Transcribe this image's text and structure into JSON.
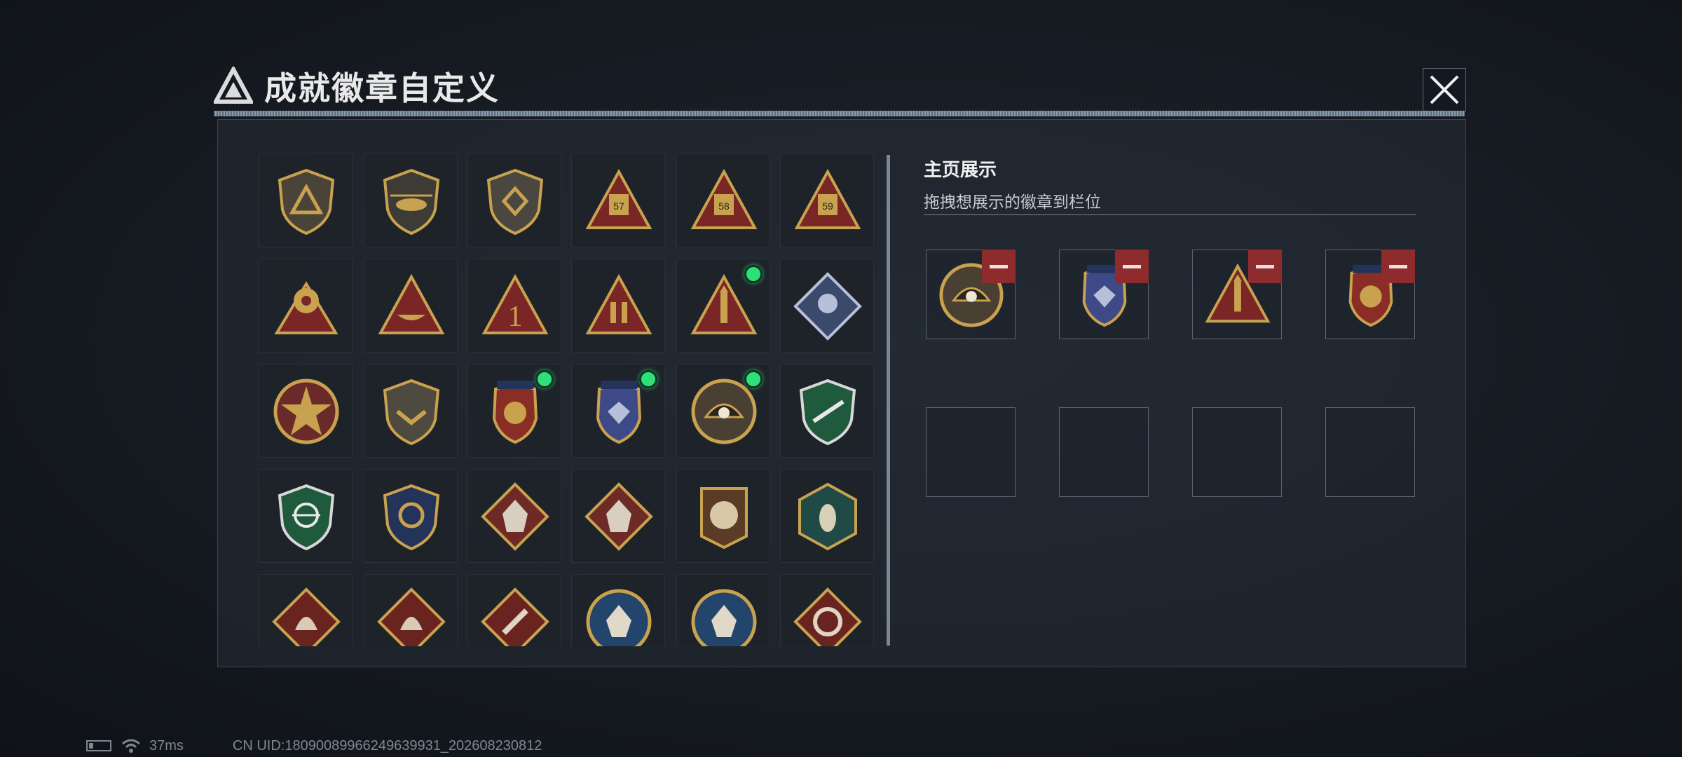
{
  "title": "成就徽章自定义",
  "right_panel": {
    "title": "主页展示",
    "subtitle": "拖拽想展示的徽章到栏位"
  },
  "status": {
    "ping": "37ms",
    "uid": "CN UID:1809008996624963993‌1_202608230812"
  },
  "colors": {
    "accent_green": "#2ee07a",
    "remove_red": "#8e2b2c",
    "gold": "#c9a24f"
  },
  "badges": [
    {
      "icon": "shield-logo-icon",
      "new": false
    },
    {
      "icon": "shield-helicopter-icon",
      "new": false
    },
    {
      "icon": "shield-emblem-icon",
      "new": false
    },
    {
      "icon": "triangle-57-icon",
      "new": false
    },
    {
      "icon": "triangle-58-icon",
      "new": false
    },
    {
      "icon": "triangle-59-icon",
      "new": false
    },
    {
      "icon": "triangle-gears-icon",
      "new": false
    },
    {
      "icon": "triangle-boat-icon",
      "new": false
    },
    {
      "icon": "triangle-number-one-icon",
      "new": false
    },
    {
      "icon": "triangle-soldiers-icon",
      "new": false
    },
    {
      "icon": "triangle-rocket-icon",
      "new": true
    },
    {
      "icon": "diamond-rose-icon",
      "new": false
    },
    {
      "icon": "star-medal-icon",
      "new": false
    },
    {
      "icon": "shield-chevron-icon",
      "new": false
    },
    {
      "icon": "crest-gold-icon",
      "new": true
    },
    {
      "icon": "crest-silver-icon",
      "new": true
    },
    {
      "icon": "circle-pearl-icon",
      "new": true
    },
    {
      "icon": "shield-green-rifle-icon",
      "new": false
    },
    {
      "icon": "shield-green-crosshair-icon",
      "new": false
    },
    {
      "icon": "shield-gold-crosshair-icon",
      "new": false
    },
    {
      "icon": "diamond-wolf-icon",
      "new": false
    },
    {
      "icon": "diamond-wolf-alt-icon",
      "new": false
    },
    {
      "icon": "square-lion-icon",
      "new": false
    },
    {
      "icon": "hexagon-wasp-icon",
      "new": false
    },
    {
      "icon": "diamond-dragon-icon",
      "new": false
    },
    {
      "icon": "diamond-dragon-alt-icon",
      "new": false
    },
    {
      "icon": "diamond-runner-icon",
      "new": false
    },
    {
      "icon": "circle-lynx-icon",
      "new": false
    },
    {
      "icon": "circle-lynx-alt-icon",
      "new": false
    },
    {
      "icon": "diamond-serpent-icon",
      "new": false
    }
  ],
  "slots": [
    {
      "icon": "circle-pearl-icon",
      "filled": true
    },
    {
      "icon": "crest-silver-icon",
      "filled": true
    },
    {
      "icon": "triangle-rocket-icon",
      "filled": true
    },
    {
      "icon": "crest-gold-icon",
      "filled": true
    },
    {
      "icon": "",
      "filled": false
    },
    {
      "icon": "",
      "filled": false
    },
    {
      "icon": "",
      "filled": false
    },
    {
      "icon": "",
      "filled": false
    }
  ]
}
